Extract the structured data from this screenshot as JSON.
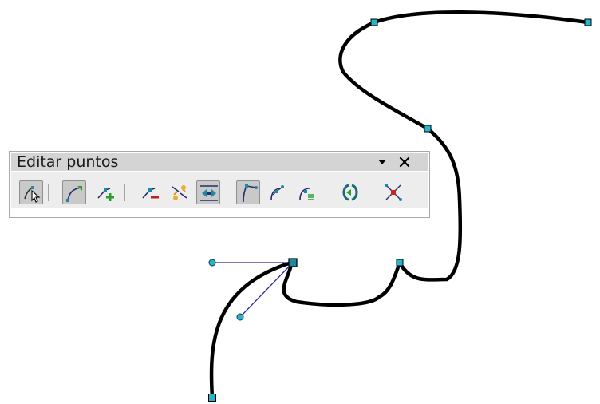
{
  "toolbar": {
    "title": "Editar puntos",
    "menu_glyph": "▾",
    "close_glyph": "✕",
    "buttons": [
      {
        "icon": "select-points-icon",
        "active": true
      },
      {
        "icon": "move-points-icon",
        "active": true
      },
      {
        "icon": "insert-points-icon",
        "active": false
      },
      {
        "icon": "delete-points-icon",
        "active": false
      },
      {
        "icon": "split-curve-icon",
        "active": false
      },
      {
        "icon": "convert-to-curve-icon",
        "active": true
      },
      {
        "icon": "corner-point-icon",
        "active": true
      },
      {
        "icon": "smooth-transition-icon",
        "active": false
      },
      {
        "icon": "symmetric-transition-icon",
        "active": false
      },
      {
        "icon": "close-bezier-icon",
        "active": false
      },
      {
        "icon": "eliminate-points-icon",
        "active": false
      }
    ]
  },
  "colors": {
    "curve": "#000000",
    "handle_point_fill": "#27b6c9",
    "handle_line": "#2a2a9e",
    "toolbar_title_bg": "#d4d4d4"
  }
}
